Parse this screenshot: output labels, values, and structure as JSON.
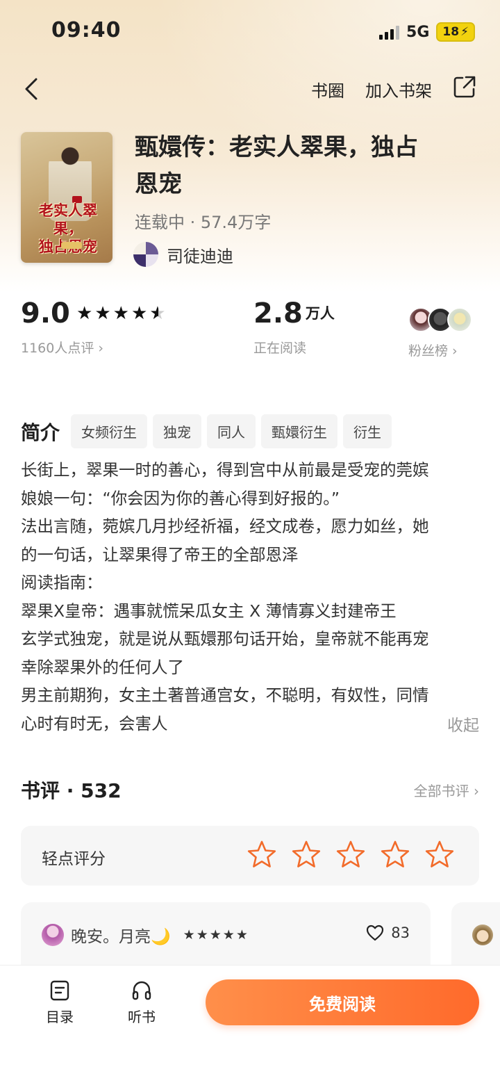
{
  "status_bar": {
    "time": "09:40",
    "network": "5G",
    "battery": "18"
  },
  "nav": {
    "circle_label": "书圈",
    "add_shelf_label": "加入书架"
  },
  "book": {
    "title_line1": "甄嬛传：老实人翠果，独占",
    "title_line2": "恩宠",
    "meta": "连载中 · 57.4万字",
    "author": "司徒迪迪",
    "cover_text_line1": "老实人翠果，",
    "cover_text_line2": "独占恩宠"
  },
  "stats": {
    "score": "9.0",
    "rating_count": "1160人点评",
    "readers_num": "2.8",
    "readers_unit": "万人",
    "readers_label": "正在阅读",
    "fans_label": "粉丝榜"
  },
  "intro": {
    "label": "简介",
    "tags": [
      "女频衍生",
      "独宠",
      "同人",
      "甄嬛衍生",
      "衍生"
    ],
    "lines": [
      "长街上，翠果一时的善心，得到宫中从前最是受宠的莞嫔",
      "娘娘一句：“你会因为你的善心得到好报的。”",
      "法出言随，菀嫔几月抄经祈福，经文成卷，愿力如丝，她",
      "的一句话，让翠果得了帝王的全部恩泽",
      "阅读指南：",
      "翠果X皇帝：遇事就慌呆瓜女主 X 薄情寡义封建帝王",
      "玄学式独宠，就是说从甄嬛那句话开始，皇帝就不能再宠",
      "幸除翠果外的任何人了",
      "男主前期狗，女主土著普通宫女，不聪明，有奴性，同情",
      "心时有时无，会害人"
    ],
    "collapse_label": "收起"
  },
  "reviews": {
    "header": "书评 · 532",
    "all_label": "全部书评",
    "rate_label": "轻点评分",
    "first": {
      "user": "晚安。月亮🌙",
      "likes": "83"
    }
  },
  "bottom": {
    "toc_label": "目录",
    "listen_label": "听书",
    "cta_label": "免费阅读"
  },
  "colors": {
    "accent": "#ff6a2b",
    "star_outline": "#f26b2a"
  }
}
